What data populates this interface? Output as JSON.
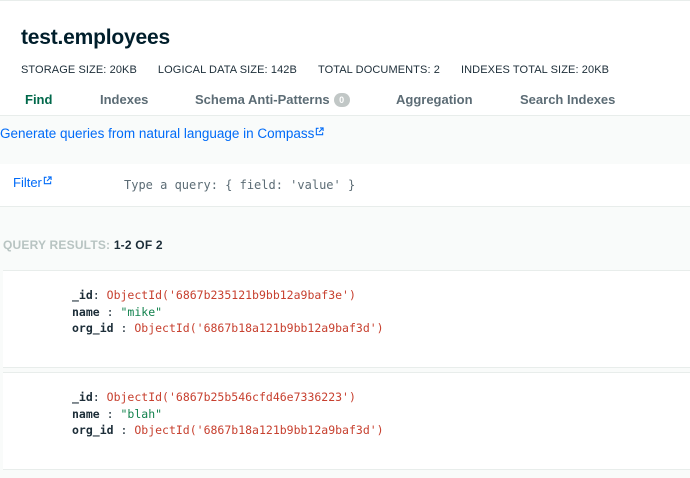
{
  "collection": {
    "title": "test.employees",
    "stats": [
      {
        "label": "STORAGE SIZE:",
        "value": "20KB"
      },
      {
        "label": "LOGICAL DATA SIZE:",
        "value": "142B"
      },
      {
        "label": "TOTAL DOCUMENTS:",
        "value": "2"
      },
      {
        "label": "INDEXES TOTAL SIZE:",
        "value": "20KB"
      }
    ]
  },
  "tabs": [
    {
      "label": "Find",
      "active": true
    },
    {
      "label": "Indexes"
    },
    {
      "label": "Schema Anti-Patterns",
      "badge": "0"
    },
    {
      "label": "Aggregation"
    },
    {
      "label": "Search Indexes"
    }
  ],
  "banner": {
    "link_text": "Generate queries from natural language in Compass"
  },
  "filter": {
    "label": "Filter",
    "placeholder": "Type a query: { field: 'value' }"
  },
  "results": {
    "prefix": "QUERY RESULTS:",
    "count": "1-2 OF 2"
  },
  "documents": [
    {
      "fields": [
        {
          "key": "_id",
          "sep": ":",
          "value": "ObjectId('6867b235121b9bb12a9baf3e')",
          "type": "oid"
        },
        {
          "key": "name",
          "sep": " :",
          "value": "\"mike\"",
          "type": "str"
        },
        {
          "key": "org_id",
          "sep": " :",
          "value": "ObjectId('6867b18a121b9bb12a9baf3d')",
          "type": "oid"
        }
      ]
    },
    {
      "fields": [
        {
          "key": "_id",
          "sep": ":",
          "value": "ObjectId('6867b25b546cfd46e7336223')",
          "type": "oid"
        },
        {
          "key": "name",
          "sep": " :",
          "value": "\"blah\"",
          "type": "str"
        },
        {
          "key": "org_id",
          "sep": " :",
          "value": "ObjectId('6867b18a121b9bb12a9baf3d')",
          "type": "oid"
        }
      ]
    }
  ],
  "colors": {
    "active_tab": "#00684a",
    "link": "#016bf8",
    "objectid": "#c7402f",
    "string": "#12824d"
  },
  "icons": {
    "external_link": "external-link-icon"
  }
}
